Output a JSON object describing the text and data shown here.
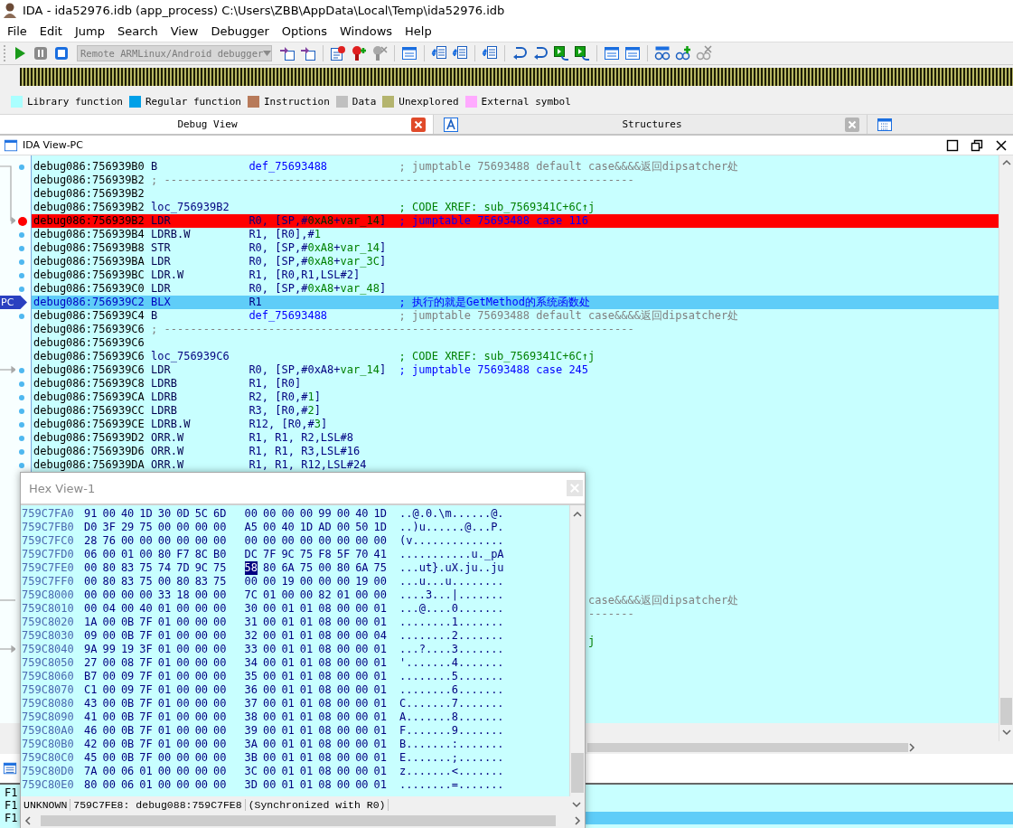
{
  "window": {
    "title": "IDA - ida52976.idb (app_process) C:\\Users\\ZBB\\AppData\\Local\\Temp\\ida52976.idb"
  },
  "menu": [
    "File",
    "Edit",
    "Jump",
    "Search",
    "View",
    "Debugger",
    "Options",
    "Windows",
    "Help"
  ],
  "toolbar": {
    "debugger_select": {
      "value": "Remote ARMLinux/Android debugger",
      "disabled": true
    }
  },
  "legend": [
    {
      "label": "Library function",
      "color": "#aaffff"
    },
    {
      "label": "Regular function",
      "color": "#00a0e8"
    },
    {
      "label": "Instruction",
      "color": "#b87a5a"
    },
    {
      "label": "Data",
      "color": "#c0c0c0"
    },
    {
      "label": "Unexplored",
      "color": "#b4b46e"
    },
    {
      "label": "External symbol",
      "color": "#ffaaff"
    }
  ],
  "tabs": [
    {
      "label": "Debug View",
      "selected": true
    },
    {
      "label": "Structures",
      "selected": false
    },
    {
      "selected": false
    }
  ],
  "ida_view": {
    "title": "IDA View-PC",
    "lines": [
      {
        "kind": "code",
        "marker": {
          "kind": "dot"
        },
        "address": "debug086:756939B0",
        "mnemonic": "B",
        "operands": [
          {
            "text": "def_75693488",
            "kind": "name"
          }
        ],
        "comment": {
          "text": "; jumptable 75693488 default case&&&&返回dipsatcher处",
          "kind": "auto"
        }
      },
      {
        "kind": "separator",
        "address": "debug086:756939B2",
        "text": "; ------------------------------------------------------------------------"
      },
      {
        "kind": "blank",
        "address": "debug086:756939B2"
      },
      {
        "kind": "label",
        "address": "debug086:756939B2",
        "label": "loc_756939B2",
        "comment": {
          "text": "; CODE XREF: sub_7569341C+6C↑j",
          "kind": "xref"
        }
      },
      {
        "kind": "code",
        "marker": {
          "kind": "breakpoint"
        },
        "highlight": {
          "kind": "breakpoint"
        },
        "address": "debug086:756939B2",
        "mnemonic": "LDR",
        "operands": [
          {
            "text": "R0, [SP,#",
            "kind": "reg"
          },
          {
            "text": "0xA8",
            "kind": "num"
          },
          {
            "text": "+",
            "kind": "reg"
          },
          {
            "text": "var_14",
            "kind": "var"
          },
          {
            "text": "]",
            "kind": "reg"
          }
        ],
        "comment": {
          "text": "; jumptable 75693488 case 116",
          "kind": "info"
        }
      },
      {
        "kind": "code",
        "marker": {
          "kind": "dot"
        },
        "address": "debug086:756939B4",
        "mnemonic": "LDRB.W",
        "operands": [
          {
            "text": "R1, [R0],#",
            "kind": "reg"
          },
          {
            "text": "1",
            "kind": "num"
          }
        ]
      },
      {
        "kind": "code",
        "marker": {
          "kind": "dot"
        },
        "address": "debug086:756939B8",
        "mnemonic": "STR",
        "operands": [
          {
            "text": "R0, [SP,#",
            "kind": "reg"
          },
          {
            "text": "0xA8",
            "kind": "num"
          },
          {
            "text": "+",
            "kind": "reg"
          },
          {
            "text": "var_14",
            "kind": "var"
          },
          {
            "text": "]",
            "kind": "reg"
          }
        ]
      },
      {
        "kind": "code",
        "marker": {
          "kind": "dot"
        },
        "address": "debug086:756939BA",
        "mnemonic": "LDR",
        "operands": [
          {
            "text": "R0, [SP,#",
            "kind": "reg"
          },
          {
            "text": "0xA8",
            "kind": "num"
          },
          {
            "text": "+",
            "kind": "reg"
          },
          {
            "text": "var_3C",
            "kind": "var"
          },
          {
            "text": "]",
            "kind": "reg"
          }
        ]
      },
      {
        "kind": "code",
        "marker": {
          "kind": "dot"
        },
        "address": "debug086:756939BC",
        "mnemonic": "LDR.W",
        "operands": [
          {
            "text": "R1, [R0,R1,LSL#2]",
            "kind": "reg"
          }
        ]
      },
      {
        "kind": "code",
        "marker": {
          "kind": "dot"
        },
        "address": "debug086:756939C0",
        "mnemonic": "LDR",
        "operands": [
          {
            "text": "R0, [SP,#",
            "kind": "reg"
          },
          {
            "text": "0xA8",
            "kind": "num"
          },
          {
            "text": "+",
            "kind": "reg"
          },
          {
            "text": "var_48",
            "kind": "var"
          },
          {
            "text": "]",
            "kind": "reg"
          }
        ]
      },
      {
        "kind": "code",
        "marker": {
          "kind": "pc"
        },
        "pc_label": "PC",
        "highlight": {
          "kind": "current"
        },
        "address": "debug086:756939C2",
        "mnemonic": "BLX",
        "operands": [
          {
            "text": "R1",
            "kind": "reg"
          }
        ],
        "comment": {
          "text": "; 执行的就是GetMethod的系统函数处",
          "kind": "info"
        }
      },
      {
        "kind": "code",
        "marker": {
          "kind": "dot"
        },
        "address": "debug086:756939C4",
        "mnemonic": "B",
        "operands": [
          {
            "text": "def_75693488",
            "kind": "name"
          }
        ],
        "comment": {
          "text": "; jumptable 75693488 default case&&&&返回dipsatcher处",
          "kind": "auto"
        }
      },
      {
        "kind": "separator",
        "address": "debug086:756939C6",
        "text": "; ------------------------------------------------------------------------"
      },
      {
        "kind": "blank",
        "address": "debug086:756939C6"
      },
      {
        "kind": "label",
        "address": "debug086:756939C6",
        "label": "loc_756939C6",
        "comment": {
          "text": "; CODE XREF: sub_7569341C+6C↑j",
          "kind": "xref"
        }
      },
      {
        "kind": "code",
        "marker": {
          "kind": "dot"
        },
        "address": "debug086:756939C6",
        "mnemonic": "LDR",
        "operands": [
          {
            "text": "R0, [SP,#",
            "kind": "reg"
          },
          {
            "text": "0xA8",
            "kind": "reg"
          },
          {
            "text": "+",
            "kind": "reg"
          },
          {
            "text": "var_14",
            "kind": "var"
          },
          {
            "text": "]",
            "kind": "reg"
          }
        ],
        "comment": {
          "text": "; jumptable 75693488 case 245",
          "kind": "info"
        }
      },
      {
        "kind": "code",
        "marker": {
          "kind": "dot"
        },
        "address": "debug086:756939C8",
        "mnemonic": "LDRB",
        "operands": [
          {
            "text": "R1, [R0]",
            "kind": "reg"
          }
        ]
      },
      {
        "kind": "code",
        "marker": {
          "kind": "dot"
        },
        "address": "debug086:756939CA",
        "mnemonic": "LDRB",
        "operands": [
          {
            "text": "R2, [R0,#",
            "kind": "reg"
          },
          {
            "text": "1",
            "kind": "num"
          },
          {
            "text": "]",
            "kind": "reg"
          }
        ]
      },
      {
        "kind": "code",
        "marker": {
          "kind": "dot"
        },
        "address": "debug086:756939CC",
        "mnemonic": "LDRB",
        "operands": [
          {
            "text": "R3, [R0,#",
            "kind": "reg"
          },
          {
            "text": "2",
            "kind": "num"
          },
          {
            "text": "]",
            "kind": "reg"
          }
        ]
      },
      {
        "kind": "code",
        "marker": {
          "kind": "dot"
        },
        "address": "debug086:756939CE",
        "mnemonic": "LDRB.W",
        "operands": [
          {
            "text": "R12, [R0,#",
            "kind": "reg"
          },
          {
            "text": "3",
            "kind": "num"
          },
          {
            "text": "]",
            "kind": "reg"
          }
        ]
      },
      {
        "kind": "code",
        "marker": {
          "kind": "dot"
        },
        "address": "debug086:756939D2",
        "mnemonic": "ORR.W",
        "operands": [
          {
            "text": "R1, R1, R2,LSL#8",
            "kind": "reg"
          }
        ]
      },
      {
        "kind": "code",
        "marker": {
          "kind": "dot"
        },
        "address": "debug086:756939D6",
        "mnemonic": "ORR.W",
        "operands": [
          {
            "text": "R1, R1, R3,LSL#16",
            "kind": "reg"
          }
        ]
      },
      {
        "kind": "code",
        "marker": {
          "kind": "dot"
        },
        "address": "debug086:756939DA",
        "mnemonic": "ORR.W",
        "operands": [
          {
            "text": "R1, R1, R12,LSL#24",
            "kind": "reg"
          }
        ]
      },
      {
        "kind": "covered"
      },
      {
        "kind": "covered"
      },
      {
        "kind": "covered"
      },
      {
        "kind": "covered"
      },
      {
        "kind": "covered"
      },
      {
        "kind": "covered"
      },
      {
        "kind": "covered"
      },
      {
        "kind": "covered"
      },
      {
        "kind": "covered"
      },
      {
        "kind": "tail",
        "comment": {
          "text": "case&&&&返回dipsatcher处",
          "kind": "auto"
        }
      },
      {
        "kind": "tail",
        "comment": {
          "text": "-------",
          "kind": "auto"
        }
      },
      {
        "kind": "covered"
      },
      {
        "kind": "tail",
        "comment": {
          "text": "j",
          "kind": "xref"
        }
      }
    ]
  },
  "hex_view": {
    "title": "Hex View-1",
    "rows": [
      {
        "address": "759C7FA0",
        "bytes": [
          {
            "v": "91",
            "selected": false
          },
          {
            "v": "00",
            "selected": false
          },
          {
            "v": "40",
            "selected": false
          },
          {
            "v": "1D",
            "selected": false
          },
          {
            "v": "30",
            "selected": false
          },
          {
            "v": "0D",
            "selected": false
          },
          {
            "v": "5C",
            "selected": false
          },
          {
            "v": "6D",
            "selected": false
          },
          {
            "v": "00",
            "selected": false
          },
          {
            "v": "00",
            "selected": false
          },
          {
            "v": "00",
            "selected": false
          },
          {
            "v": "00",
            "selected": false
          },
          {
            "v": "99",
            "selected": false
          },
          {
            "v": "00",
            "selected": false
          },
          {
            "v": "40",
            "selected": false
          },
          {
            "v": "1D",
            "selected": false
          }
        ],
        "ascii": "..@.0.\\m......@."
      },
      {
        "address": "759C7FB0",
        "bytes": [
          {
            "v": "D0",
            "selected": false
          },
          {
            "v": "3F",
            "selected": false
          },
          {
            "v": "29",
            "selected": false
          },
          {
            "v": "75",
            "selected": false
          },
          {
            "v": "00",
            "selected": false
          },
          {
            "v": "00",
            "selected": false
          },
          {
            "v": "00",
            "selected": false
          },
          {
            "v": "00",
            "selected": false
          },
          {
            "v": "A5",
            "selected": false
          },
          {
            "v": "00",
            "selected": false
          },
          {
            "v": "40",
            "selected": false
          },
          {
            "v": "1D",
            "selected": false
          },
          {
            "v": "AD",
            "selected": false
          },
          {
            "v": "00",
            "selected": false
          },
          {
            "v": "50",
            "selected": false
          },
          {
            "v": "1D",
            "selected": false
          }
        ],
        "ascii": "..)u......@...P."
      },
      {
        "address": "759C7FC0",
        "bytes": [
          {
            "v": "28",
            "selected": false
          },
          {
            "v": "76",
            "selected": false
          },
          {
            "v": "00",
            "selected": false
          },
          {
            "v": "00",
            "selected": false
          },
          {
            "v": "00",
            "selected": false
          },
          {
            "v": "00",
            "selected": false
          },
          {
            "v": "00",
            "selected": false
          },
          {
            "v": "00",
            "selected": false
          },
          {
            "v": "00",
            "selected": false
          },
          {
            "v": "00",
            "selected": false
          },
          {
            "v": "00",
            "selected": false
          },
          {
            "v": "00",
            "selected": false
          },
          {
            "v": "00",
            "selected": false
          },
          {
            "v": "00",
            "selected": false
          },
          {
            "v": "00",
            "selected": false
          },
          {
            "v": "00",
            "selected": false
          }
        ],
        "ascii": "(v.............."
      },
      {
        "address": "759C7FD0",
        "bytes": [
          {
            "v": "06",
            "selected": false
          },
          {
            "v": "00",
            "selected": false
          },
          {
            "v": "01",
            "selected": false
          },
          {
            "v": "00",
            "selected": false
          },
          {
            "v": "80",
            "selected": false
          },
          {
            "v": "F7",
            "selected": false
          },
          {
            "v": "8C",
            "selected": false
          },
          {
            "v": "B0",
            "selected": false
          },
          {
            "v": "DC",
            "selected": false
          },
          {
            "v": "7F",
            "selected": false
          },
          {
            "v": "9C",
            "selected": false
          },
          {
            "v": "75",
            "selected": false
          },
          {
            "v": "F8",
            "selected": false
          },
          {
            "v": "5F",
            "selected": false
          },
          {
            "v": "70",
            "selected": false
          },
          {
            "v": "41",
            "selected": false
          }
        ],
        "ascii": "...........u._pA"
      },
      {
        "address": "759C7FE0",
        "bytes": [
          {
            "v": "00",
            "selected": false
          },
          {
            "v": "80",
            "selected": false
          },
          {
            "v": "83",
            "selected": false
          },
          {
            "v": "75",
            "selected": false
          },
          {
            "v": "74",
            "selected": false
          },
          {
            "v": "7D",
            "selected": false
          },
          {
            "v": "9C",
            "selected": false
          },
          {
            "v": "75",
            "selected": false
          },
          {
            "v": "58",
            "selected": true
          },
          {
            "v": "80",
            "selected": false
          },
          {
            "v": "6A",
            "selected": false
          },
          {
            "v": "75",
            "selected": false
          },
          {
            "v": "00",
            "selected": false
          },
          {
            "v": "80",
            "selected": false
          },
          {
            "v": "6A",
            "selected": false
          },
          {
            "v": "75",
            "selected": false
          }
        ],
        "ascii": "...ut}.uX.ju..ju"
      },
      {
        "address": "759C7FF0",
        "bytes": [
          {
            "v": "00",
            "selected": false
          },
          {
            "v": "80",
            "selected": false
          },
          {
            "v": "83",
            "selected": false
          },
          {
            "v": "75",
            "selected": false
          },
          {
            "v": "00",
            "selected": false
          },
          {
            "v": "80",
            "selected": false
          },
          {
            "v": "83",
            "selected": false
          },
          {
            "v": "75",
            "selected": false
          },
          {
            "v": "00",
            "selected": false
          },
          {
            "v": "00",
            "selected": false
          },
          {
            "v": "19",
            "selected": false
          },
          {
            "v": "00",
            "selected": false
          },
          {
            "v": "00",
            "selected": false
          },
          {
            "v": "00",
            "selected": false
          },
          {
            "v": "19",
            "selected": false
          },
          {
            "v": "00",
            "selected": false
          }
        ],
        "ascii": "...u...u........"
      },
      {
        "address": "759C8000",
        "bytes": [
          {
            "v": "00",
            "selected": false
          },
          {
            "v": "00",
            "selected": false
          },
          {
            "v": "00",
            "selected": false
          },
          {
            "v": "00",
            "selected": false
          },
          {
            "v": "33",
            "selected": false
          },
          {
            "v": "18",
            "selected": false
          },
          {
            "v": "00",
            "selected": false
          },
          {
            "v": "00",
            "selected": false
          },
          {
            "v": "7C",
            "selected": false
          },
          {
            "v": "01",
            "selected": false
          },
          {
            "v": "00",
            "selected": false
          },
          {
            "v": "00",
            "selected": false
          },
          {
            "v": "82",
            "selected": false
          },
          {
            "v": "01",
            "selected": false
          },
          {
            "v": "00",
            "selected": false
          },
          {
            "v": "00",
            "selected": false
          }
        ],
        "ascii": "....3...|......."
      },
      {
        "address": "759C8010",
        "bytes": [
          {
            "v": "00",
            "selected": false
          },
          {
            "v": "04",
            "selected": false
          },
          {
            "v": "00",
            "selected": false
          },
          {
            "v": "40",
            "selected": false
          },
          {
            "v": "01",
            "selected": false
          },
          {
            "v": "00",
            "selected": false
          },
          {
            "v": "00",
            "selected": false
          },
          {
            "v": "00",
            "selected": false
          },
          {
            "v": "30",
            "selected": false
          },
          {
            "v": "00",
            "selected": false
          },
          {
            "v": "01",
            "selected": false
          },
          {
            "v": "01",
            "selected": false
          },
          {
            "v": "08",
            "selected": false
          },
          {
            "v": "00",
            "selected": false
          },
          {
            "v": "00",
            "selected": false
          },
          {
            "v": "01",
            "selected": false
          }
        ],
        "ascii": "...@....0......."
      },
      {
        "address": "759C8020",
        "bytes": [
          {
            "v": "1A",
            "selected": false
          },
          {
            "v": "00",
            "selected": false
          },
          {
            "v": "0B",
            "selected": false
          },
          {
            "v": "7F",
            "selected": false
          },
          {
            "v": "01",
            "selected": false
          },
          {
            "v": "00",
            "selected": false
          },
          {
            "v": "00",
            "selected": false
          },
          {
            "v": "00",
            "selected": false
          },
          {
            "v": "31",
            "selected": false
          },
          {
            "v": "00",
            "selected": false
          },
          {
            "v": "01",
            "selected": false
          },
          {
            "v": "01",
            "selected": false
          },
          {
            "v": "08",
            "selected": false
          },
          {
            "v": "00",
            "selected": false
          },
          {
            "v": "00",
            "selected": false
          },
          {
            "v": "01",
            "selected": false
          }
        ],
        "ascii": "........1......."
      },
      {
        "address": "759C8030",
        "bytes": [
          {
            "v": "09",
            "selected": false
          },
          {
            "v": "00",
            "selected": false
          },
          {
            "v": "0B",
            "selected": false
          },
          {
            "v": "7F",
            "selected": false
          },
          {
            "v": "01",
            "selected": false
          },
          {
            "v": "00",
            "selected": false
          },
          {
            "v": "00",
            "selected": false
          },
          {
            "v": "00",
            "selected": false
          },
          {
            "v": "32",
            "selected": false
          },
          {
            "v": "00",
            "selected": false
          },
          {
            "v": "01",
            "selected": false
          },
          {
            "v": "01",
            "selected": false
          },
          {
            "v": "08",
            "selected": false
          },
          {
            "v": "00",
            "selected": false
          },
          {
            "v": "00",
            "selected": false
          },
          {
            "v": "04",
            "selected": false
          }
        ],
        "ascii": "........2......."
      },
      {
        "address": "759C8040",
        "bytes": [
          {
            "v": "9A",
            "selected": false
          },
          {
            "v": "99",
            "selected": false
          },
          {
            "v": "19",
            "selected": false
          },
          {
            "v": "3F",
            "selected": false
          },
          {
            "v": "01",
            "selected": false
          },
          {
            "v": "00",
            "selected": false
          },
          {
            "v": "00",
            "selected": false
          },
          {
            "v": "00",
            "selected": false
          },
          {
            "v": "33",
            "selected": false
          },
          {
            "v": "00",
            "selected": false
          },
          {
            "v": "01",
            "selected": false
          },
          {
            "v": "01",
            "selected": false
          },
          {
            "v": "08",
            "selected": false
          },
          {
            "v": "00",
            "selected": false
          },
          {
            "v": "00",
            "selected": false
          },
          {
            "v": "01",
            "selected": false
          }
        ],
        "ascii": "...?....3......."
      },
      {
        "address": "759C8050",
        "bytes": [
          {
            "v": "27",
            "selected": false
          },
          {
            "v": "00",
            "selected": false
          },
          {
            "v": "08",
            "selected": false
          },
          {
            "v": "7F",
            "selected": false
          },
          {
            "v": "01",
            "selected": false
          },
          {
            "v": "00",
            "selected": false
          },
          {
            "v": "00",
            "selected": false
          },
          {
            "v": "00",
            "selected": false
          },
          {
            "v": "34",
            "selected": false
          },
          {
            "v": "00",
            "selected": false
          },
          {
            "v": "01",
            "selected": false
          },
          {
            "v": "01",
            "selected": false
          },
          {
            "v": "08",
            "selected": false
          },
          {
            "v": "00",
            "selected": false
          },
          {
            "v": "00",
            "selected": false
          },
          {
            "v": "01",
            "selected": false
          }
        ],
        "ascii": "'.......4......."
      },
      {
        "address": "759C8060",
        "bytes": [
          {
            "v": "B7",
            "selected": false
          },
          {
            "v": "00",
            "selected": false
          },
          {
            "v": "09",
            "selected": false
          },
          {
            "v": "7F",
            "selected": false
          },
          {
            "v": "01",
            "selected": false
          },
          {
            "v": "00",
            "selected": false
          },
          {
            "v": "00",
            "selected": false
          },
          {
            "v": "00",
            "selected": false
          },
          {
            "v": "35",
            "selected": false
          },
          {
            "v": "00",
            "selected": false
          },
          {
            "v": "01",
            "selected": false
          },
          {
            "v": "01",
            "selected": false
          },
          {
            "v": "08",
            "selected": false
          },
          {
            "v": "00",
            "selected": false
          },
          {
            "v": "00",
            "selected": false
          },
          {
            "v": "01",
            "selected": false
          }
        ],
        "ascii": "........5......."
      },
      {
        "address": "759C8070",
        "bytes": [
          {
            "v": "C1",
            "selected": false
          },
          {
            "v": "00",
            "selected": false
          },
          {
            "v": "09",
            "selected": false
          },
          {
            "v": "7F",
            "selected": false
          },
          {
            "v": "01",
            "selected": false
          },
          {
            "v": "00",
            "selected": false
          },
          {
            "v": "00",
            "selected": false
          },
          {
            "v": "00",
            "selected": false
          },
          {
            "v": "36",
            "selected": false
          },
          {
            "v": "00",
            "selected": false
          },
          {
            "v": "01",
            "selected": false
          },
          {
            "v": "01",
            "selected": false
          },
          {
            "v": "08",
            "selected": false
          },
          {
            "v": "00",
            "selected": false
          },
          {
            "v": "00",
            "selected": false
          },
          {
            "v": "01",
            "selected": false
          }
        ],
        "ascii": "........6......."
      },
      {
        "address": "759C8080",
        "bytes": [
          {
            "v": "43",
            "selected": false
          },
          {
            "v": "00",
            "selected": false
          },
          {
            "v": "0B",
            "selected": false
          },
          {
            "v": "7F",
            "selected": false
          },
          {
            "v": "01",
            "selected": false
          },
          {
            "v": "00",
            "selected": false
          },
          {
            "v": "00",
            "selected": false
          },
          {
            "v": "00",
            "selected": false
          },
          {
            "v": "37",
            "selected": false
          },
          {
            "v": "00",
            "selected": false
          },
          {
            "v": "01",
            "selected": false
          },
          {
            "v": "01",
            "selected": false
          },
          {
            "v": "08",
            "selected": false
          },
          {
            "v": "00",
            "selected": false
          },
          {
            "v": "00",
            "selected": false
          },
          {
            "v": "01",
            "selected": false
          }
        ],
        "ascii": "C.......7......."
      },
      {
        "address": "759C8090",
        "bytes": [
          {
            "v": "41",
            "selected": false
          },
          {
            "v": "00",
            "selected": false
          },
          {
            "v": "0B",
            "selected": false
          },
          {
            "v": "7F",
            "selected": false
          },
          {
            "v": "01",
            "selected": false
          },
          {
            "v": "00",
            "selected": false
          },
          {
            "v": "00",
            "selected": false
          },
          {
            "v": "00",
            "selected": false
          },
          {
            "v": "38",
            "selected": false
          },
          {
            "v": "00",
            "selected": false
          },
          {
            "v": "01",
            "selected": false
          },
          {
            "v": "01",
            "selected": false
          },
          {
            "v": "08",
            "selected": false
          },
          {
            "v": "00",
            "selected": false
          },
          {
            "v": "00",
            "selected": false
          },
          {
            "v": "01",
            "selected": false
          }
        ],
        "ascii": "A.......8......."
      },
      {
        "address": "759C80A0",
        "bytes": [
          {
            "v": "46",
            "selected": false
          },
          {
            "v": "00",
            "selected": false
          },
          {
            "v": "0B",
            "selected": false
          },
          {
            "v": "7F",
            "selected": false
          },
          {
            "v": "01",
            "selected": false
          },
          {
            "v": "00",
            "selected": false
          },
          {
            "v": "00",
            "selected": false
          },
          {
            "v": "00",
            "selected": false
          },
          {
            "v": "39",
            "selected": false
          },
          {
            "v": "00",
            "selected": false
          },
          {
            "v": "01",
            "selected": false
          },
          {
            "v": "01",
            "selected": false
          },
          {
            "v": "08",
            "selected": false
          },
          {
            "v": "00",
            "selected": false
          },
          {
            "v": "00",
            "selected": false
          },
          {
            "v": "01",
            "selected": false
          }
        ],
        "ascii": "F.......9......."
      },
      {
        "address": "759C80B0",
        "bytes": [
          {
            "v": "42",
            "selected": false
          },
          {
            "v": "00",
            "selected": false
          },
          {
            "v": "0B",
            "selected": false
          },
          {
            "v": "7F",
            "selected": false
          },
          {
            "v": "01",
            "selected": false
          },
          {
            "v": "00",
            "selected": false
          },
          {
            "v": "00",
            "selected": false
          },
          {
            "v": "00",
            "selected": false
          },
          {
            "v": "3A",
            "selected": false
          },
          {
            "v": "00",
            "selected": false
          },
          {
            "v": "01",
            "selected": false
          },
          {
            "v": "01",
            "selected": false
          },
          {
            "v": "08",
            "selected": false
          },
          {
            "v": "00",
            "selected": false
          },
          {
            "v": "00",
            "selected": false
          },
          {
            "v": "01",
            "selected": false
          }
        ],
        "ascii": "B.......:......."
      },
      {
        "address": "759C80C0",
        "bytes": [
          {
            "v": "45",
            "selected": false
          },
          {
            "v": "00",
            "selected": false
          },
          {
            "v": "0B",
            "selected": false
          },
          {
            "v": "7F",
            "selected": false
          },
          {
            "v": "00",
            "selected": false
          },
          {
            "v": "00",
            "selected": false
          },
          {
            "v": "00",
            "selected": false
          },
          {
            "v": "00",
            "selected": false
          },
          {
            "v": "3B",
            "selected": false
          },
          {
            "v": "00",
            "selected": false
          },
          {
            "v": "01",
            "selected": false
          },
          {
            "v": "01",
            "selected": false
          },
          {
            "v": "08",
            "selected": false
          },
          {
            "v": "00",
            "selected": false
          },
          {
            "v": "00",
            "selected": false
          },
          {
            "v": "01",
            "selected": false
          }
        ],
        "ascii": "E.......;......."
      },
      {
        "address": "759C80D0",
        "bytes": [
          {
            "v": "7A",
            "selected": false
          },
          {
            "v": "00",
            "selected": false
          },
          {
            "v": "06",
            "selected": false
          },
          {
            "v": "01",
            "selected": false
          },
          {
            "v": "00",
            "selected": false
          },
          {
            "v": "00",
            "selected": false
          },
          {
            "v": "00",
            "selected": false
          },
          {
            "v": "00",
            "selected": false
          },
          {
            "v": "3C",
            "selected": false
          },
          {
            "v": "00",
            "selected": false
          },
          {
            "v": "01",
            "selected": false
          },
          {
            "v": "01",
            "selected": false
          },
          {
            "v": "08",
            "selected": false
          },
          {
            "v": "00",
            "selected": false
          },
          {
            "v": "00",
            "selected": false
          },
          {
            "v": "01",
            "selected": false
          }
        ],
        "ascii": "z.......<......."
      },
      {
        "address": "759C80E0",
        "bytes": [
          {
            "v": "80",
            "selected": false
          },
          {
            "v": "00",
            "selected": false
          },
          {
            "v": "06",
            "selected": false
          },
          {
            "v": "01",
            "selected": false
          },
          {
            "v": "00",
            "selected": false
          },
          {
            "v": "00",
            "selected": false
          },
          {
            "v": "00",
            "selected": false
          },
          {
            "v": "00",
            "selected": false
          },
          {
            "v": "3D",
            "selected": false
          },
          {
            "v": "00",
            "selected": false
          },
          {
            "v": "01",
            "selected": false
          },
          {
            "v": "01",
            "selected": false
          },
          {
            "v": "08",
            "selected": false
          },
          {
            "v": "00",
            "selected": false
          },
          {
            "v": "00",
            "selected": false
          },
          {
            "v": "01",
            "selected": false
          }
        ],
        "ascii": "........=......."
      }
    ],
    "status": [
      "UNKNOWN",
      "759C7FE8: debug088:759C7FE8",
      "(Synchronized with R0)"
    ]
  },
  "output": {
    "lines": [
      {
        "text": "F1",
        "selected": false
      },
      {
        "text": "F1",
        "selected": false
      },
      {
        "text": "F1",
        "selected": true
      }
    ]
  }
}
